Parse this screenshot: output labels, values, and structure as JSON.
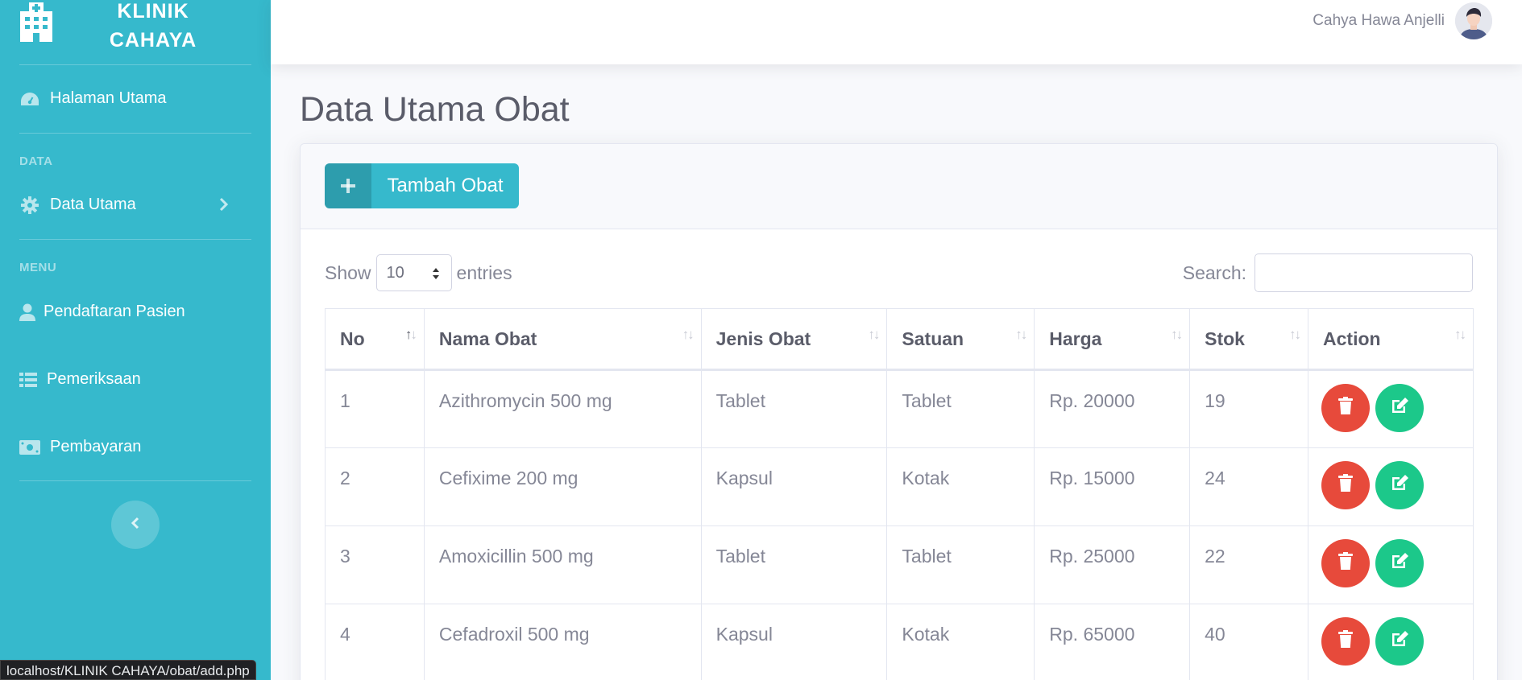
{
  "sidebar": {
    "brand": {
      "line1": "KLINIK",
      "line2": "CAHAYA"
    },
    "items": [
      {
        "label": "Halaman Utama",
        "icon": "dashboard-icon"
      },
      {
        "label": "Data Utama",
        "icon": "gear-icon"
      },
      {
        "label": "Pendaftaran Pasien",
        "icon": "user-icon"
      },
      {
        "label": "Pemeriksaan",
        "icon": "table-icon"
      },
      {
        "label": "Pembayaran",
        "icon": "money-icon"
      }
    ],
    "headings": {
      "data": "DATA",
      "menu": "MENU"
    }
  },
  "topbar": {
    "user_name": "Cahya Hawa Anjelli"
  },
  "page": {
    "title": "Data Utama Obat"
  },
  "card": {
    "add_button": "Tambah Obat"
  },
  "datatable": {
    "show_label": "Show",
    "entries_value": "10",
    "entries_label": "entries",
    "search_label": "Search:",
    "search_value": "",
    "columns": [
      "No",
      "Nama Obat",
      "Jenis Obat",
      "Satuan",
      "Harga",
      "Stok",
      "Action"
    ],
    "rows": [
      {
        "no": "1",
        "nama": "Azithromycin 500 mg",
        "jenis": "Tablet",
        "satuan": "Tablet",
        "harga": "Rp. 20000",
        "stok": "19"
      },
      {
        "no": "2",
        "nama": "Cefixime 200 mg",
        "jenis": "Kapsul",
        "satuan": "Kotak",
        "harga": "Rp. 15000",
        "stok": "24"
      },
      {
        "no": "3",
        "nama": "Amoxicillin 500 mg",
        "jenis": "Tablet",
        "satuan": "Tablet",
        "harga": "Rp. 25000",
        "stok": "22"
      },
      {
        "no": "4",
        "nama": "Cefadroxil 500 mg",
        "jenis": "Kapsul",
        "satuan": "Kotak",
        "harga": "Rp. 65000",
        "stok": "40"
      }
    ]
  },
  "statusbar": {
    "url": "localhost/KLINIK CAHAYA/obat/add.php"
  },
  "colors": {
    "sidebar": "#36b9cc",
    "danger": "#e74a3b",
    "success": "#1cc88a"
  }
}
